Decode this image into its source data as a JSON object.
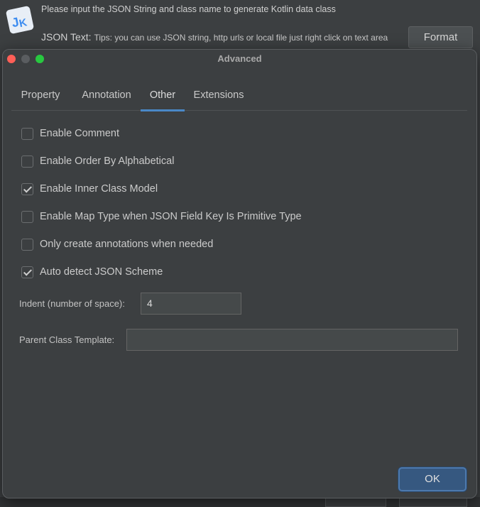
{
  "background": {
    "info_text": "Please input the JSON String and class name to generate Kotlin data class",
    "json_label": "JSON Text:",
    "json_tips": "Tips: you can use JSON string, http urls or local file just right click on text area",
    "format_button": "Format",
    "logo_text": "JK",
    "colors": {
      "logo_blue": "#3d8cf0",
      "logo_bg": "#e8eef6"
    }
  },
  "dialog": {
    "title": "Advanced",
    "tabs": [
      {
        "label": "Property",
        "active": false
      },
      {
        "label": "Annotation",
        "active": false
      },
      {
        "label": "Other",
        "active": true
      },
      {
        "label": "Extensions",
        "active": false
      }
    ],
    "options": [
      {
        "label": "Enable Comment",
        "checked": false
      },
      {
        "label": "Enable Order By Alphabetical",
        "checked": false
      },
      {
        "label": "Enable Inner Class Model",
        "checked": true
      },
      {
        "label": "Enable Map Type when JSON Field Key Is Primitive Type",
        "checked": false
      },
      {
        "label": "Only create annotations when needed",
        "checked": false
      },
      {
        "label": "Auto detect JSON Scheme",
        "checked": true
      }
    ],
    "indent": {
      "label": "Indent (number of space):",
      "value": "4"
    },
    "parent_template": {
      "label": "Parent Class Template:",
      "value": ""
    },
    "ok_button": "OK",
    "colors": {
      "accent": "#4a88c7",
      "ok_bg": "#365880",
      "close": "#fe5f57",
      "maximize": "#28c840"
    }
  }
}
